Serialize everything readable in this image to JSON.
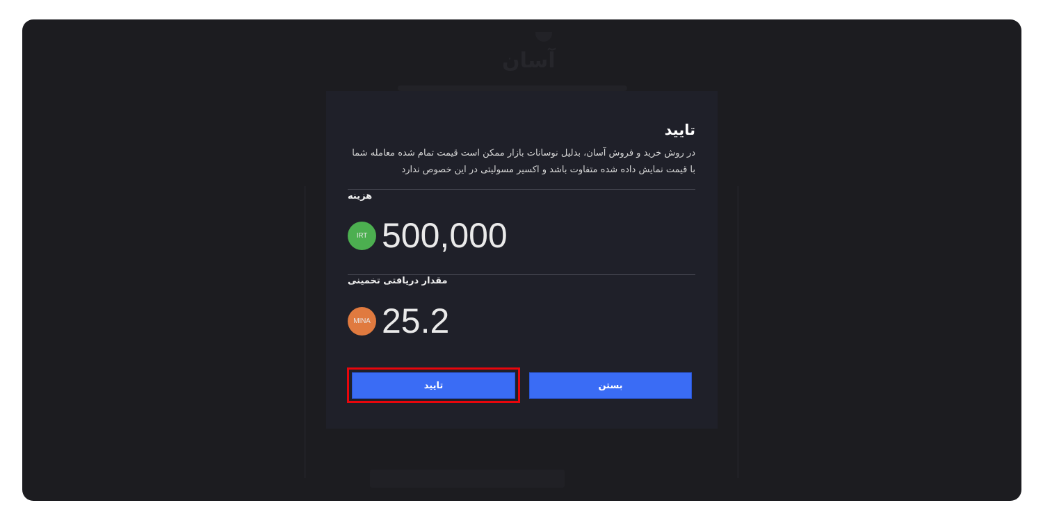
{
  "background": {
    "ghost_title": "آسان"
  },
  "modal": {
    "title": "تایید",
    "description": "در روش خرید و فروش آسان، بدلیل نوسانات بازار ممکن است قیمت تمام شده معامله شما با قیمت نمایش داده شده متفاوت باشد و اکسیر مسولیتی در این خصوص ندارد",
    "cost": {
      "label": "هزینه",
      "currency": "IRT",
      "currency_color": "#4caf50",
      "value": "500,000"
    },
    "estimated": {
      "label": "مقدار دریافتی تخمینی",
      "currency": "MINA",
      "currency_color": "#e07a3f",
      "value": "25.2"
    },
    "buttons": {
      "confirm_label": "تایید",
      "close_label": "بستن"
    }
  },
  "colors": {
    "accent": "#3a6cf5",
    "highlight": "#e8060c",
    "modal_bg": "#1f2029",
    "page_bg": "#1c1c20"
  }
}
